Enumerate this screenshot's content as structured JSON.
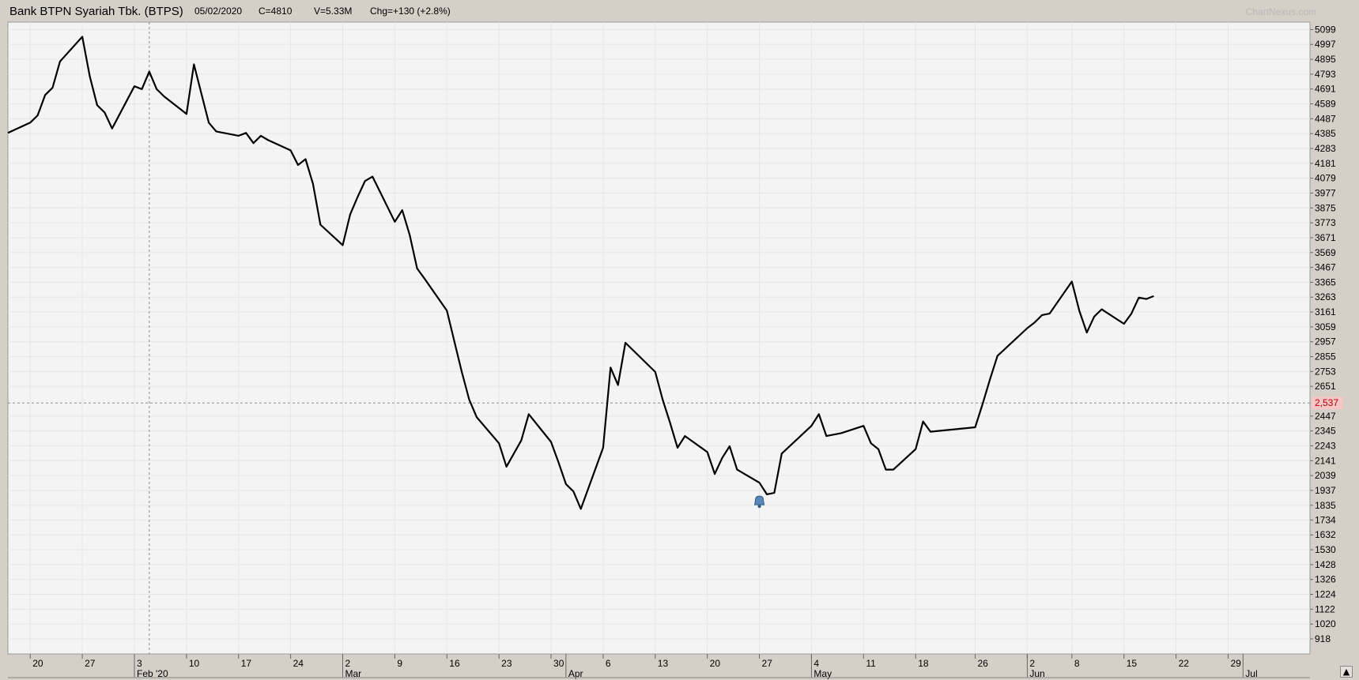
{
  "header": {
    "title": "Bank BTPN Syariah Tbk. (BTPS)",
    "date": "05/02/2020",
    "close": "C=4810",
    "volume": "V=5.33M",
    "change": "Chg=+130 (+2.8%)",
    "watermark": "ChartNexus.com"
  },
  "crosshair": {
    "price_label": "2,537",
    "price": 2537,
    "date": "2020-02-05"
  },
  "colors": {
    "background": "#f4f4f4",
    "grid": "#e6e6e6",
    "line": "#000000",
    "crosshair_label_bg": "#f6c6c6",
    "marker": "#5a86b8"
  },
  "icons": {
    "marker": "bell-icon",
    "scroll": "up-arrow-icon"
  },
  "chart_data": {
    "type": "line",
    "title": "Bank BTPN Syariah Tbk. (BTPS)",
    "xlabel": "",
    "ylabel": "",
    "grid": true,
    "x_range": [
      "2020-01-17",
      "2020-07-10"
    ],
    "ylim": [
      815,
      5150
    ],
    "y_ticks": [
      918,
      1020,
      1122,
      1224,
      1326,
      1428,
      1530,
      1632,
      1734,
      1835,
      1937,
      2039,
      2141,
      2243,
      2345,
      2447,
      2651,
      2753,
      2855,
      2957,
      3059,
      3161,
      3263,
      3365,
      3467,
      3569,
      3671,
      3773,
      3875,
      3977,
      4079,
      4181,
      4283,
      4385,
      4487,
      4589,
      4691,
      4793,
      4895,
      4997,
      5099
    ],
    "x_day_ticks": [
      {
        "label": "20",
        "date": "2020-01-20"
      },
      {
        "label": "27",
        "date": "2020-01-27"
      },
      {
        "label": "3",
        "date": "2020-02-03"
      },
      {
        "label": "10",
        "date": "2020-02-10"
      },
      {
        "label": "17",
        "date": "2020-02-17"
      },
      {
        "label": "24",
        "date": "2020-02-24"
      },
      {
        "label": "2",
        "date": "2020-03-02"
      },
      {
        "label": "9",
        "date": "2020-03-09"
      },
      {
        "label": "16",
        "date": "2020-03-16"
      },
      {
        "label": "23",
        "date": "2020-03-23"
      },
      {
        "label": "30",
        "date": "2020-03-30"
      },
      {
        "label": "6",
        "date": "2020-04-06"
      },
      {
        "label": "13",
        "date": "2020-04-13"
      },
      {
        "label": "20",
        "date": "2020-04-20"
      },
      {
        "label": "27",
        "date": "2020-04-27"
      },
      {
        "label": "4",
        "date": "2020-05-04"
      },
      {
        "label": "11",
        "date": "2020-05-11"
      },
      {
        "label": "18",
        "date": "2020-05-18"
      },
      {
        "label": "26",
        "date": "2020-05-26"
      },
      {
        "label": "2",
        "date": "2020-06-02"
      },
      {
        "label": "8",
        "date": "2020-06-08"
      },
      {
        "label": "15",
        "date": "2020-06-15"
      },
      {
        "label": "22",
        "date": "2020-06-22"
      },
      {
        "label": "29",
        "date": "2020-06-29"
      }
    ],
    "x_month_ticks": [
      {
        "label": "Feb '20",
        "date": "2020-02-03"
      },
      {
        "label": "Mar",
        "date": "2020-03-02"
      },
      {
        "label": "Apr",
        "date": "2020-04-01"
      },
      {
        "label": "May",
        "date": "2020-05-04"
      },
      {
        "label": "Jun",
        "date": "2020-06-02"
      },
      {
        "label": "Jul",
        "date": "2020-07-01"
      }
    ],
    "marker": {
      "date": "2020-04-27",
      "price": 1860
    },
    "series": [
      {
        "x": [
          "2020-01-17",
          "2020-01-20",
          "2020-01-21",
          "2020-01-22",
          "2020-01-23",
          "2020-01-24",
          "2020-01-27",
          "2020-01-28",
          "2020-01-29",
          "2020-01-30",
          "2020-01-31",
          "2020-02-03",
          "2020-02-04",
          "2020-02-05",
          "2020-02-06",
          "2020-02-07",
          "2020-02-10",
          "2020-02-11",
          "2020-02-12",
          "2020-02-13",
          "2020-02-14",
          "2020-02-17",
          "2020-02-18",
          "2020-02-19",
          "2020-02-20",
          "2020-02-21",
          "2020-02-24",
          "2020-02-25",
          "2020-02-26",
          "2020-02-27",
          "2020-02-28",
          "2020-03-02",
          "2020-03-03",
          "2020-03-04",
          "2020-03-05",
          "2020-03-06",
          "2020-03-09",
          "2020-03-10",
          "2020-03-11",
          "2020-03-12",
          "2020-03-13",
          "2020-03-16",
          "2020-03-17",
          "2020-03-18",
          "2020-03-19",
          "2020-03-20",
          "2020-03-23",
          "2020-03-24",
          "2020-03-26",
          "2020-03-27",
          "2020-03-30",
          "2020-03-31",
          "2020-04-01",
          "2020-04-02",
          "2020-04-03",
          "2020-04-06",
          "2020-04-07",
          "2020-04-08",
          "2020-04-09",
          "2020-04-13",
          "2020-04-14",
          "2020-04-15",
          "2020-04-16",
          "2020-04-17",
          "2020-04-20",
          "2020-04-21",
          "2020-04-22",
          "2020-04-23",
          "2020-04-24",
          "2020-04-27",
          "2020-04-28",
          "2020-04-29",
          "2020-04-30",
          "2020-05-04",
          "2020-05-05",
          "2020-05-06",
          "2020-05-08",
          "2020-05-11",
          "2020-05-12",
          "2020-05-13",
          "2020-05-14",
          "2020-05-15",
          "2020-05-18",
          "2020-05-19",
          "2020-05-20",
          "2020-05-26",
          "2020-05-27",
          "2020-05-28",
          "2020-05-29",
          "2020-06-02",
          "2020-06-03",
          "2020-06-04",
          "2020-06-05",
          "2020-06-08",
          "2020-06-09",
          "2020-06-10",
          "2020-06-11",
          "2020-06-12",
          "2020-06-15",
          "2020-06-16",
          "2020-06-17",
          "2020-06-18",
          "2020-06-19"
        ],
        "y": [
          4390,
          4460,
          4510,
          4650,
          4700,
          4880,
          5050,
          4780,
          4580,
          4530,
          4420,
          4710,
          4690,
          4810,
          4690,
          4640,
          4520,
          4860,
          4660,
          4460,
          4400,
          4370,
          4390,
          4320,
          4370,
          4340,
          4270,
          4170,
          4210,
          4040,
          3760,
          3620,
          3830,
          3950,
          4060,
          4090,
          3780,
          3860,
          3690,
          3460,
          3390,
          3170,
          2960,
          2750,
          2560,
          2440,
          2260,
          2100,
          2280,
          2460,
          2270,
          2130,
          1980,
          1930,
          1810,
          2230,
          2780,
          2660,
          2950,
          2750,
          2560,
          2400,
          2230,
          2310,
          2200,
          2050,
          2160,
          2240,
          2080,
          1990,
          1910,
          1920,
          2190,
          2380,
          2460,
          2310,
          2330,
          2380,
          2260,
          2220,
          2080,
          2080,
          2220,
          2410,
          2340,
          2370,
          2530,
          2700,
          2860,
          3050,
          3090,
          3140,
          3150,
          3370,
          3170,
          3020,
          3130,
          3180,
          3080,
          3150,
          3260,
          3250,
          3270
        ]
      }
    ]
  }
}
